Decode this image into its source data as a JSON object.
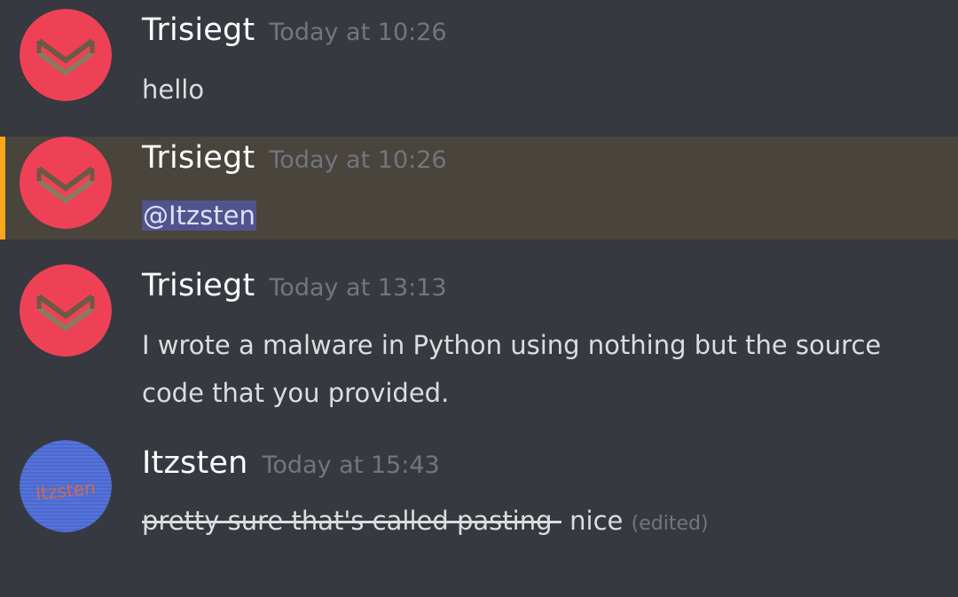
{
  "colors": {
    "background": "#36393f",
    "mention_highlight": "#49443c",
    "mention_bar": "#faa81a",
    "username": "#ffffff",
    "timestamp": "#72767d",
    "text": "#dcddde",
    "avatar_red": "#ef4155",
    "avatar_blue": "#4d6cd2"
  },
  "messages": [
    {
      "author": "Trisiegt",
      "timestamp": "Today at 10:26",
      "avatar_icon": "red-chevron-logo-icon",
      "text": "hello"
    },
    {
      "author": "Trisiegt",
      "timestamp": "Today at 10:26",
      "avatar_icon": "red-chevron-logo-icon",
      "mention": "@Itzsten",
      "highlighted": true
    },
    {
      "author": "Trisiegt",
      "timestamp": "Today at 13:13",
      "avatar_icon": "red-chevron-logo-icon",
      "lines": [
        "I wrote a malware in Python using nothing but the source",
        "code that you provided."
      ]
    },
    {
      "author": "Itzsten",
      "timestamp": "Today at 15:43",
      "avatar_icon": "blue-handwritten-avatar-icon",
      "avatar_text": "Itzsten",
      "struck_text": "pretty sure that's called pasting-",
      "text": " nice",
      "edited_label": "(edited)"
    }
  ]
}
